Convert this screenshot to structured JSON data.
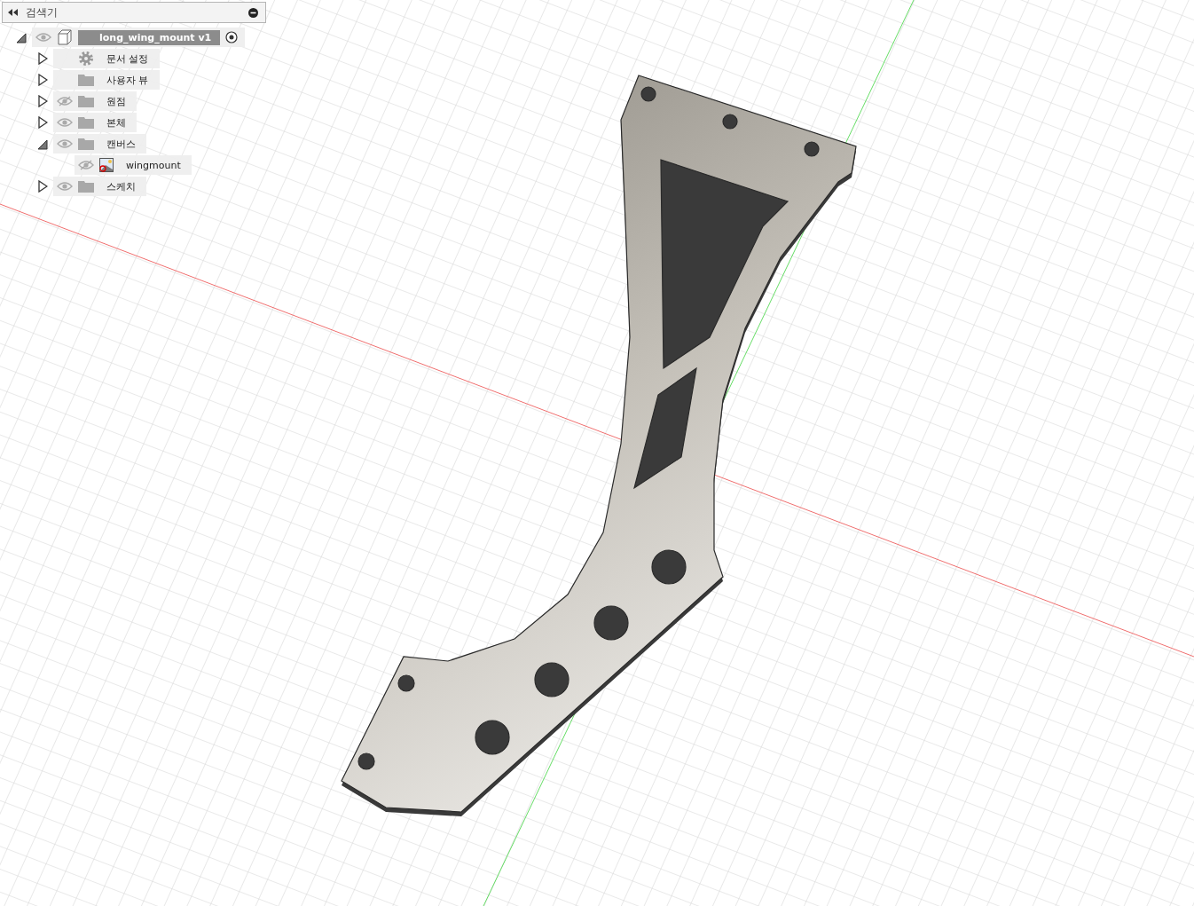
{
  "browser": {
    "title": "검색기"
  },
  "tree": {
    "label": "long_wing_mount v1",
    "kind": "component",
    "expanded": true,
    "visible": true,
    "selected": true,
    "children": [
      {
        "label": "문서 설정",
        "kind": "settings",
        "expanded": false
      },
      {
        "label": "사용자 뷰",
        "kind": "folder",
        "expanded": false
      },
      {
        "label": "원점",
        "kind": "folder",
        "expanded": false,
        "visible": false
      },
      {
        "label": "본체",
        "kind": "folder",
        "expanded": false,
        "visible": true
      },
      {
        "label": "캔버스",
        "kind": "folder",
        "expanded": true,
        "visible": true,
        "children": [
          {
            "label": "wingmount",
            "kind": "canvas",
            "visible": false
          }
        ]
      },
      {
        "label": "스케치",
        "kind": "folder",
        "expanded": false,
        "visible": true
      }
    ]
  }
}
